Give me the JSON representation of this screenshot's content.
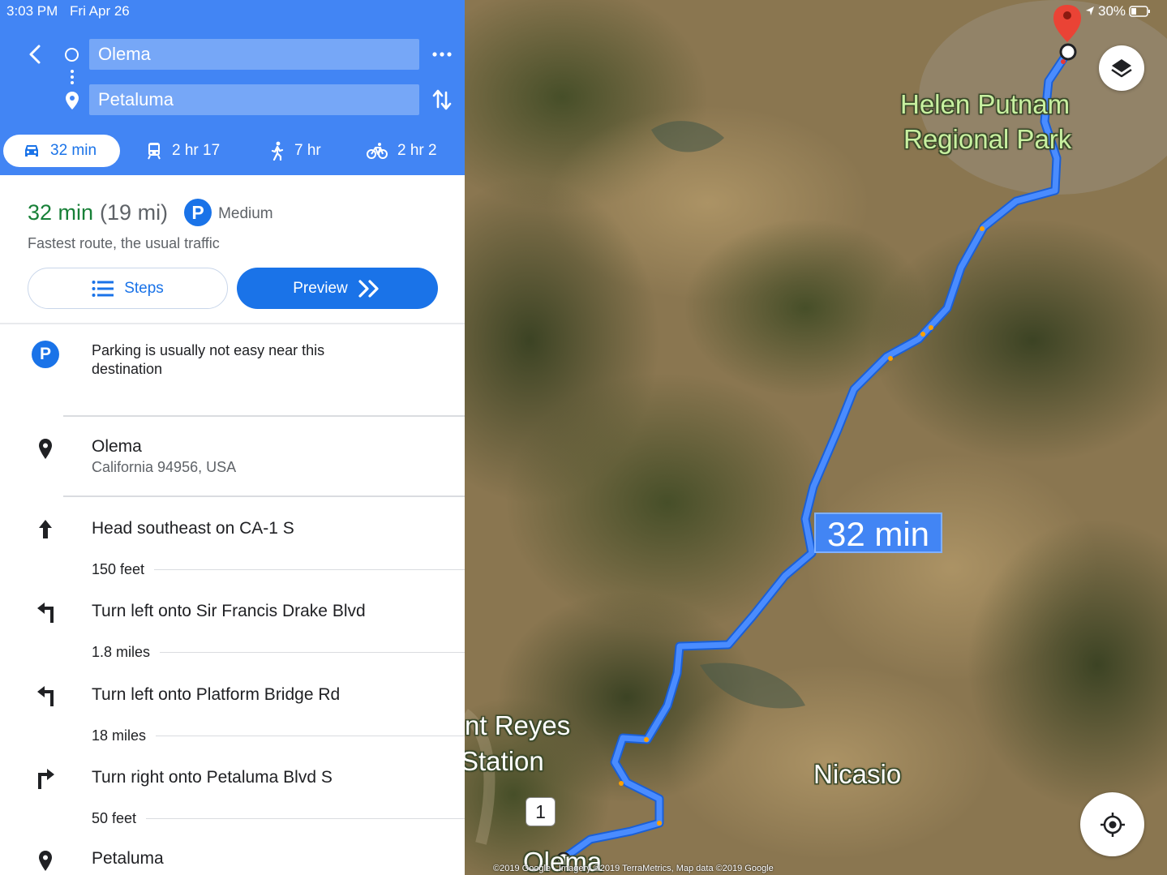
{
  "status_bar": {
    "time": "3:03 PM",
    "date": "Fri Apr 26",
    "battery": "30%"
  },
  "search": {
    "origin": "Olema",
    "destination": "Petaluma"
  },
  "modes": [
    {
      "label": "32 min",
      "icon": "car-icon"
    },
    {
      "label": "2 hr 17",
      "icon": "train-icon"
    },
    {
      "label": "7 hr",
      "icon": "walk-icon"
    },
    {
      "label": "2 hr 2",
      "icon": "bike-icon"
    }
  ],
  "summary": {
    "time": "32 min",
    "distance": "(19 mi)",
    "parking_badge": "P",
    "parking_level": "Medium",
    "description": "Fastest route, the usual traffic",
    "steps_label": "Steps",
    "preview_label": "Preview"
  },
  "parking_note": "Parking is usually not easy near this destination",
  "origin_place": {
    "name": "Olema",
    "address": "California 94956, USA"
  },
  "steps": [
    {
      "instruction": "Head southeast on CA-1 S",
      "distance": "150 feet",
      "icon": "arrow-up-icon"
    },
    {
      "instruction": "Turn left onto Sir Francis Drake Blvd",
      "distance": "1.8 miles",
      "icon": "turn-left-icon"
    },
    {
      "instruction": "Turn left onto Platform Bridge Rd",
      "distance": "18 miles",
      "icon": "turn-left-icon"
    },
    {
      "instruction": "Turn right onto Petaluma Blvd S",
      "distance": "50 feet",
      "icon": "turn-right-icon"
    }
  ],
  "destination_place": {
    "name": "Petaluma"
  },
  "map": {
    "park_label_1": "Helen Putnam",
    "park_label_2": "Regional Park",
    "town_reyes_1": "nt Reyes",
    "town_reyes_2": "Station",
    "town_nicasio": "Nicasio",
    "town_olema": "Olema",
    "route_time": "32 min",
    "highway_shield": "1",
    "copyright": "©2019 Google · Imagery ©2019 TerraMetrics, Map data ©2019 Google"
  },
  "colors": {
    "header": "#4285f4",
    "accent": "#1a73e8",
    "time_green": "#188038",
    "route": "#4285f4"
  }
}
